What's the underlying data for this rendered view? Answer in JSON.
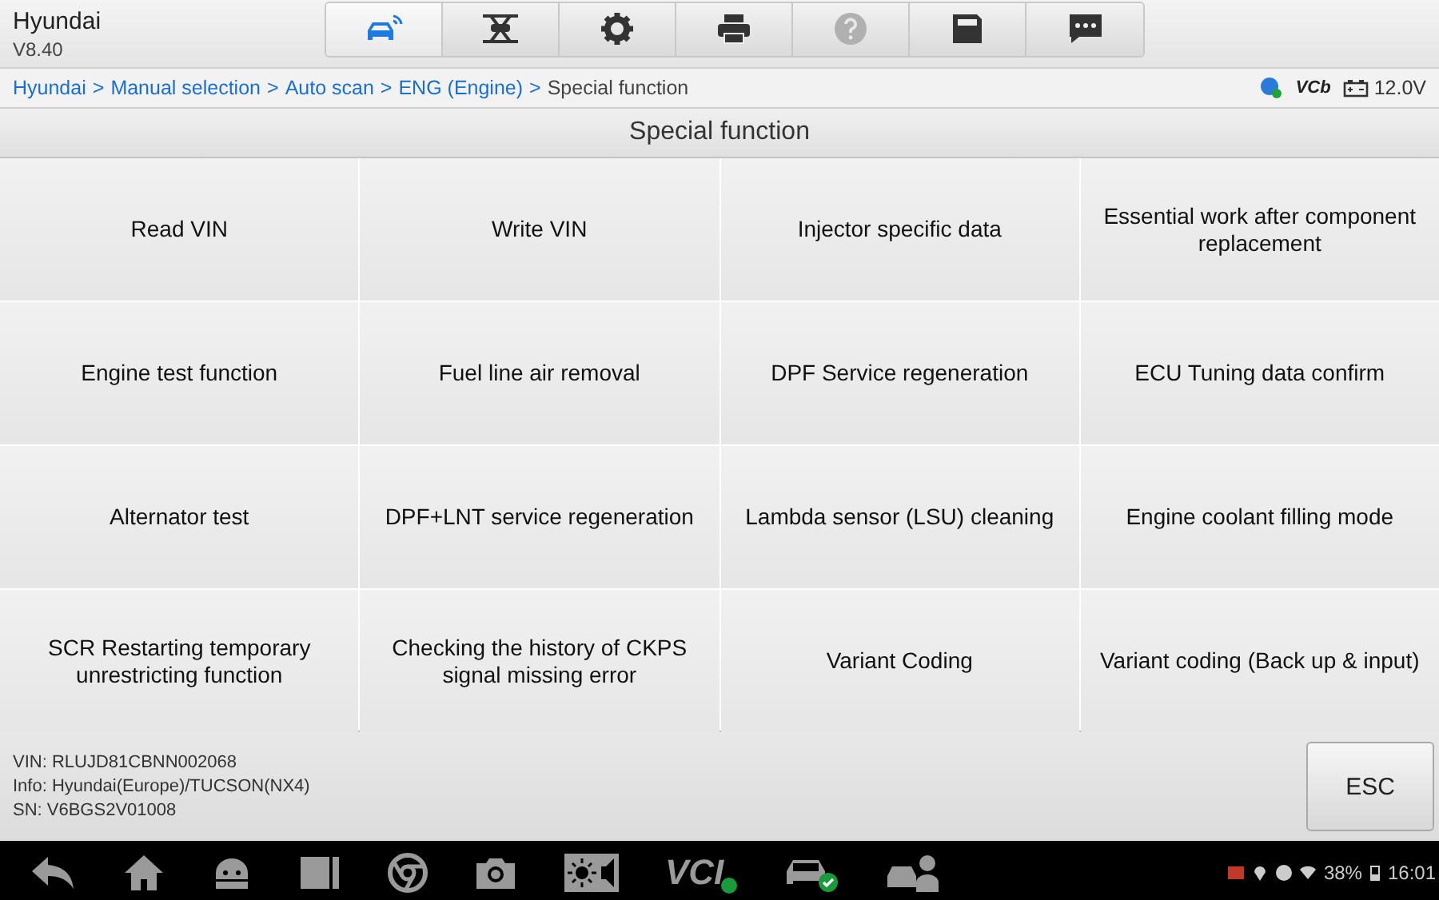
{
  "app": {
    "title": "Hyundai",
    "version": "V8.40"
  },
  "toolbar": [
    {
      "kind": "car-wifi",
      "selected": true,
      "disabled": false
    },
    {
      "kind": "lift",
      "selected": false,
      "disabled": false
    },
    {
      "kind": "gear",
      "selected": false,
      "disabled": false
    },
    {
      "kind": "printer",
      "selected": false,
      "disabled": false
    },
    {
      "kind": "help",
      "selected": false,
      "disabled": true
    },
    {
      "kind": "save",
      "selected": false,
      "disabled": false
    },
    {
      "kind": "chat",
      "selected": false,
      "disabled": false
    }
  ],
  "breadcrumb": {
    "separator": ">",
    "items": [
      {
        "label": "Hyundai",
        "current": false
      },
      {
        "label": "Manual selection",
        "current": false
      },
      {
        "label": "Auto scan",
        "current": false
      },
      {
        "label": "ENG (Engine)",
        "current": false
      },
      {
        "label": "Special function",
        "current": true
      }
    ]
  },
  "status": {
    "vci": "VCb",
    "voltage": "12.0V"
  },
  "page_title": "Special function",
  "functions": [
    {
      "label": "Read VIN"
    },
    {
      "label": "Write VIN"
    },
    {
      "label": "Injector specific data"
    },
    {
      "label": "Essential work after component replacement"
    },
    {
      "label": "Engine test function"
    },
    {
      "label": "Fuel line air removal"
    },
    {
      "label": "DPF Service regeneration"
    },
    {
      "label": "ECU Tuning data confirm"
    },
    {
      "label": "Alternator test"
    },
    {
      "label": "DPF+LNT service regeneration"
    },
    {
      "label": "Lambda sensor (LSU) cleaning"
    },
    {
      "label": "Engine coolant filling mode"
    },
    {
      "label": "SCR Restarting temporary unrestricting function"
    },
    {
      "label": "Checking the history of CKPS signal missing error"
    },
    {
      "label": "Variant Coding"
    },
    {
      "label": "Variant coding (Back up & input)"
    }
  ],
  "vehicle_info": [
    "VIN: RLUJD81CBNN002068",
    "Info: Hyundai(Europe)/TUCSON(NX4)",
    "SN: V6BGS2V01008"
  ],
  "esc_button": "ESC",
  "nav_bar": [
    {
      "kind": "back"
    },
    {
      "kind": "home"
    },
    {
      "kind": "android"
    },
    {
      "kind": "recents"
    },
    {
      "kind": "chrome"
    },
    {
      "kind": "camera"
    },
    {
      "kind": "brightness"
    },
    {
      "kind": "vci",
      "label": "VCI"
    },
    {
      "kind": "car-check"
    },
    {
      "kind": "person-car"
    }
  ],
  "system_status": {
    "battery": "38%",
    "time": "16:01"
  }
}
